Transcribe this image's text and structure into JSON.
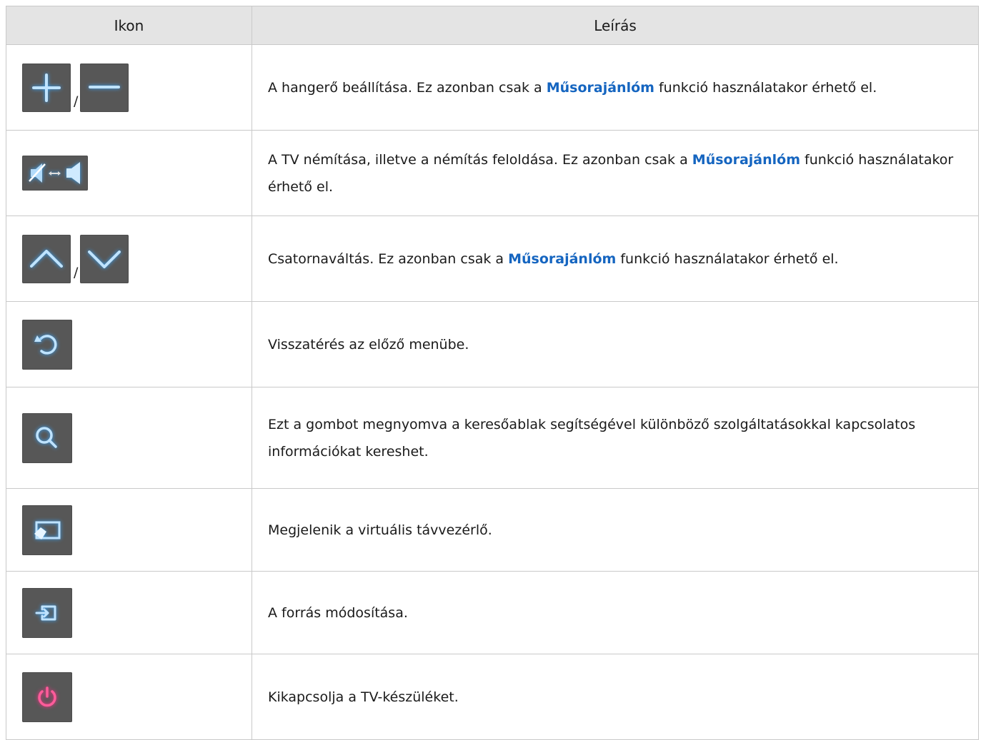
{
  "header": {
    "icon_col": "Ikon",
    "desc_col": "Leírás"
  },
  "colors": {
    "icon_bg": "#575757",
    "accent_blue": "#2e9bff",
    "power_pink": "#e8246f",
    "highlight": "#1565c0"
  },
  "rows": [
    {
      "icons": [
        "plus-icon",
        "minus-icon"
      ],
      "separator": "/",
      "desc_before": "A hangerő beállítása. Ez azonban csak a ",
      "desc_highlight": "Műsorajánlóm",
      "desc_after": " funkció használatakor érhető el."
    },
    {
      "icons": [
        "mute-toggle-icon"
      ],
      "desc_before": "A TV némítása, illetve a némítás feloldása. Ez azonban csak a ",
      "desc_highlight": "Műsorajánlóm",
      "desc_after": " funkció használatakor érhető el."
    },
    {
      "icons": [
        "chevron-up-icon",
        "chevron-down-icon"
      ],
      "separator": "/",
      "desc_before": "Csatornaváltás. Ez azonban csak a ",
      "desc_highlight": "Műsorajánlóm",
      "desc_after": " funkció használatakor érhető el."
    },
    {
      "icons": [
        "return-icon"
      ],
      "desc": "Visszatérés az előző menübe."
    },
    {
      "icons": [
        "search-icon"
      ],
      "desc": "Ezt a gombot megnyomva a keresőablak segítségével különböző szolgáltatásokkal kapcsolatos információkat kereshet."
    },
    {
      "icons": [
        "virtual-remote-icon"
      ],
      "desc": "Megjelenik a virtuális távvezérlő."
    },
    {
      "icons": [
        "source-icon"
      ],
      "desc": "A forrás módosítása."
    },
    {
      "icons": [
        "power-icon"
      ],
      "desc": "Kikapcsolja a TV-készüléket."
    }
  ]
}
